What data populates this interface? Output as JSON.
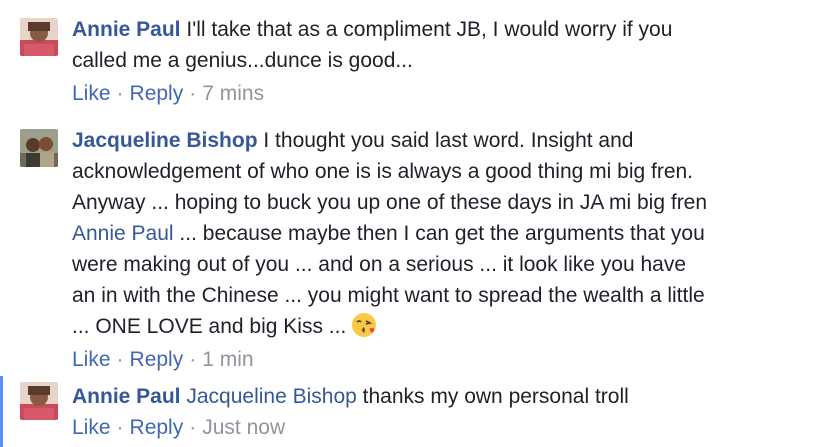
{
  "comments": [
    {
      "author": "Annie Paul",
      "line1": "I'll take that as a compliment JB, I would worry if you",
      "line2": "called me a genius...dunce is good...",
      "like": "Like",
      "reply": "Reply",
      "time": "7 mins"
    },
    {
      "author": "Jacqueline Bishop",
      "line1": "I thought you said last word. Insight and",
      "line2": "acknowledgement of who one is is always a good thing mi big fren.",
      "line3": "Anyway ... hoping to buck you up one of these days in JA mi big fren",
      "mention": "Annie Paul",
      "line4": "... because maybe then I can get the arguments that you",
      "line5": "were making out of you ... and on a serious ... it look like you have",
      "line6": "an in with the Chinese ... you might want to spread the wealth a little",
      "line7": "... ONE LOVE and big Kiss ...",
      "emoji": "kissing-face-icon",
      "like": "Like",
      "reply": "Reply",
      "time": "1 min"
    },
    {
      "author": "Annie Paul",
      "mention": "Jacqueline Bishop",
      "text": "thanks my own personal troll",
      "like": "Like",
      "reply": "Reply",
      "time": "Just now"
    }
  ],
  "colors": {
    "author": "#365899",
    "link": "#4267b2",
    "meta": "#90949c",
    "highlight_bar": "#5890ff"
  }
}
